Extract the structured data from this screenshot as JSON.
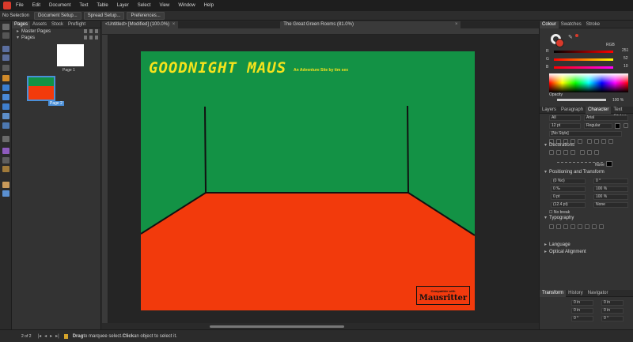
{
  "menubar": {
    "items": [
      "File",
      "Edit",
      "Document",
      "Text",
      "Table",
      "Layer",
      "Select",
      "View",
      "Window",
      "Help"
    ]
  },
  "context": {
    "selection": "No Selection",
    "buttons": [
      "Document Setup...",
      "Spread Setup...",
      "Preferences..."
    ]
  },
  "left_panel": {
    "tabs": [
      "Pages",
      "Assets",
      "Stock",
      "Preflight"
    ],
    "master_pages": "Master Pages",
    "pages_label": "Pages",
    "page1_label": "Page 1",
    "page2_label": "Page 2"
  },
  "doc_tabs": {
    "tab1": "<Untitled> [Modified] (100.0%)",
    "tab2": "The Great Green Rooms (81.0%)"
  },
  "page": {
    "title": "GOODNIGHT MAUS",
    "subtitle": "An Adventure Site by tim sex",
    "badge_top": "Compatible with",
    "badge_bottom": "Mausritter"
  },
  "colors": {
    "page_green": "#139245",
    "floor_red": "#f23a0c",
    "title_yellow": "#f5e31c",
    "accent_blue": "#4a8fd8",
    "app_red": "#d93a2b"
  },
  "status": {
    "page_count": "2 of 2",
    "hint_bold1": "Drag",
    "hint1": " to marquee select. ",
    "hint_bold2": "Click",
    "hint2": " an object to select it."
  },
  "right_panel": {
    "colour_tabs": [
      "Colour",
      "Swatches",
      "Stroke"
    ],
    "model": "RGB",
    "r_value": "251",
    "g_value": "52",
    "b_value": "10",
    "opacity_label": "Opacity",
    "opacity_value": "100 %",
    "text_tabs": [
      "Layers",
      "Paragraph",
      "Character",
      "Text Styles"
    ],
    "lang_all": "All",
    "font_name": "Arial",
    "font_size": "12 pt",
    "font_style": "Regular",
    "style_none": "[No Style]",
    "decorations": "Decorations",
    "none_label": "None",
    "positioning": "Positioning and Transform",
    "pos_fields": [
      "(0 %o)",
      "0 °",
      "0 ‰",
      "100 %",
      "0 pt",
      "100 %",
      "(12.4 pt)",
      "None"
    ],
    "no_break": "No break",
    "typography": "Typography",
    "language": "Language",
    "optical": "Optical Alignment",
    "bottom_tabs": [
      "Transform",
      "History",
      "Navigator"
    ],
    "transform_fields": [
      "0 in",
      "0 in",
      "0 in",
      "0 in",
      "0 °",
      "0 °"
    ]
  }
}
